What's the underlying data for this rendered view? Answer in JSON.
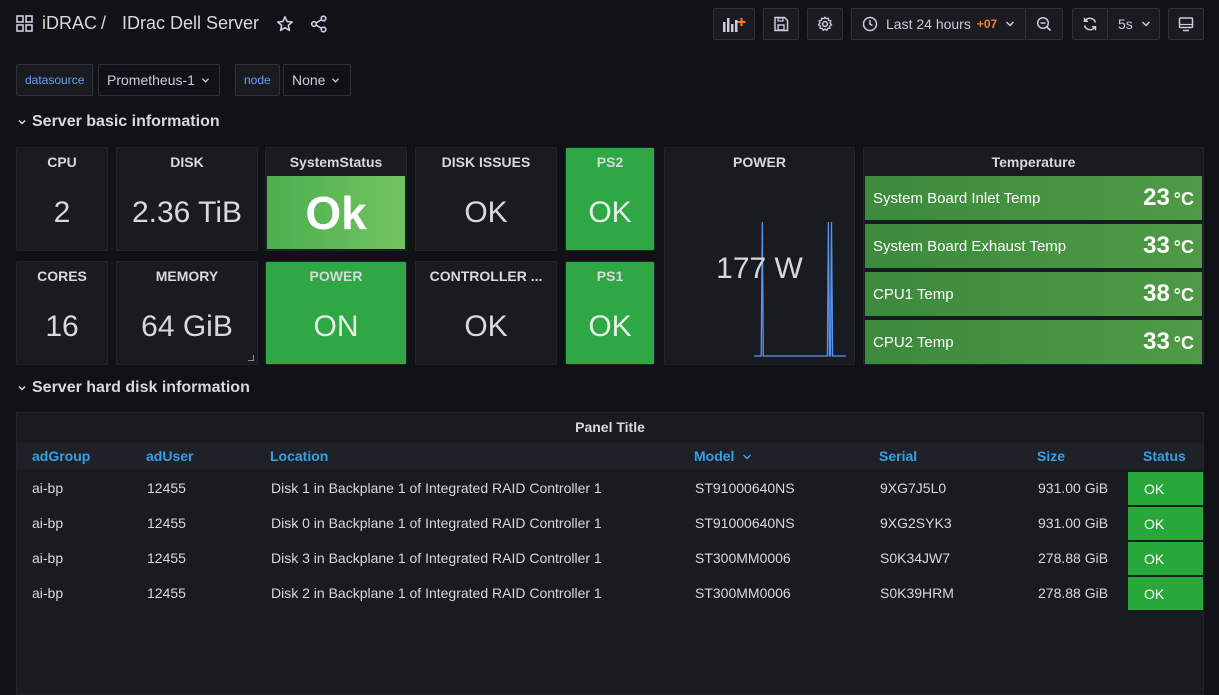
{
  "header": {
    "breadcrumb_root": "iDRAC",
    "breadcrumb_sep": "/",
    "dashboard_title": "IDrac Dell Server",
    "time_range_label": "Last 24 hours",
    "time_zone": "+07",
    "refresh_interval": "5s"
  },
  "variables": [
    {
      "label": "datasource",
      "value": "Prometheus-1"
    },
    {
      "label": "node",
      "value": "None"
    }
  ],
  "rows": [
    {
      "title": "Server basic information"
    },
    {
      "title": "Server hard disk information"
    }
  ],
  "stats": {
    "cpu": {
      "title": "CPU",
      "value": "2"
    },
    "disk": {
      "title": "DISK",
      "value": "2.36 TiB"
    },
    "system_status": {
      "title": "SystemStatus",
      "value": "Ok"
    },
    "disk_issues": {
      "title": "DISK ISSUES",
      "value": "OK"
    },
    "ps2": {
      "title": "PS2",
      "value": "OK"
    },
    "power": {
      "title": "POWER",
      "value": "177 W",
      "sparkline": [
        0,
        0,
        0,
        0,
        0,
        0,
        0,
        0,
        1,
        0,
        0,
        0,
        0,
        0,
        0,
        0,
        0,
        0,
        0,
        0,
        0,
        0,
        0,
        0,
        0,
        0,
        0,
        0,
        0,
        0,
        0,
        0,
        0,
        0,
        0,
        0,
        0,
        0,
        0,
        0,
        0,
        0,
        0,
        0,
        0,
        0,
        0,
        0,
        0,
        0,
        0,
        0,
        0,
        0,
        0,
        0,
        0,
        0,
        0,
        0,
        0,
        0,
        0,
        0,
        0,
        0,
        0,
        0,
        0,
        0,
        0,
        0,
        1,
        0,
        0,
        1,
        0,
        0,
        0,
        0,
        0,
        0,
        0,
        0,
        0,
        0,
        0,
        0,
        0,
        0
      ]
    },
    "cores": {
      "title": "CORES",
      "value": "16"
    },
    "memory": {
      "title": "MEMORY",
      "value": "64 GiB"
    },
    "power_state": {
      "title": "POWER",
      "value": "ON"
    },
    "controller": {
      "title": "CONTROLLER ...",
      "value": "OK"
    },
    "ps1": {
      "title": "PS1",
      "value": "OK"
    }
  },
  "temperature": {
    "title": "Temperature",
    "unit": "°C",
    "items": [
      {
        "name": "System Board Inlet Temp",
        "value": "23"
      },
      {
        "name": "System Board Exhaust Temp",
        "value": "33"
      },
      {
        "name": "CPU1 Temp",
        "value": "38"
      },
      {
        "name": "CPU2 Temp",
        "value": "33"
      }
    ]
  },
  "disk_table": {
    "title": "Panel Title",
    "columns": [
      "adGroup",
      "adUser",
      "Location",
      "Model",
      "Serial",
      "Size",
      "Status"
    ],
    "rows": [
      [
        "ai-bp",
        "12455",
        "Disk 1 in Backplane 1 of Integrated RAID Controller 1",
        "ST91000640NS",
        "9XG7J5L0",
        "931.00 GiB",
        "OK"
      ],
      [
        "ai-bp",
        "12455",
        "Disk 0 in Backplane 1 of Integrated RAID Controller 1",
        "ST91000640NS",
        "9XG2SYK3",
        "931.00 GiB",
        "OK"
      ],
      [
        "ai-bp",
        "12455",
        "Disk 3 in Backplane 1 of Integrated RAID Controller 1",
        "ST300MM0006",
        "S0K34JW7",
        "278.88 GiB",
        "OK"
      ],
      [
        "ai-bp",
        "12455",
        "Disk 2 in Backplane 1 of Integrated RAID Controller 1",
        "ST300MM0006",
        "S0K39HRM",
        "278.88 GiB",
        "OK"
      ]
    ]
  },
  "colors": {
    "background": "#111217",
    "panel": "#181b1f",
    "ok_green": "#2ea744",
    "link_blue": "#33a2e5",
    "timezone_orange": "#ff7830",
    "sparkline": "#5794f2"
  }
}
